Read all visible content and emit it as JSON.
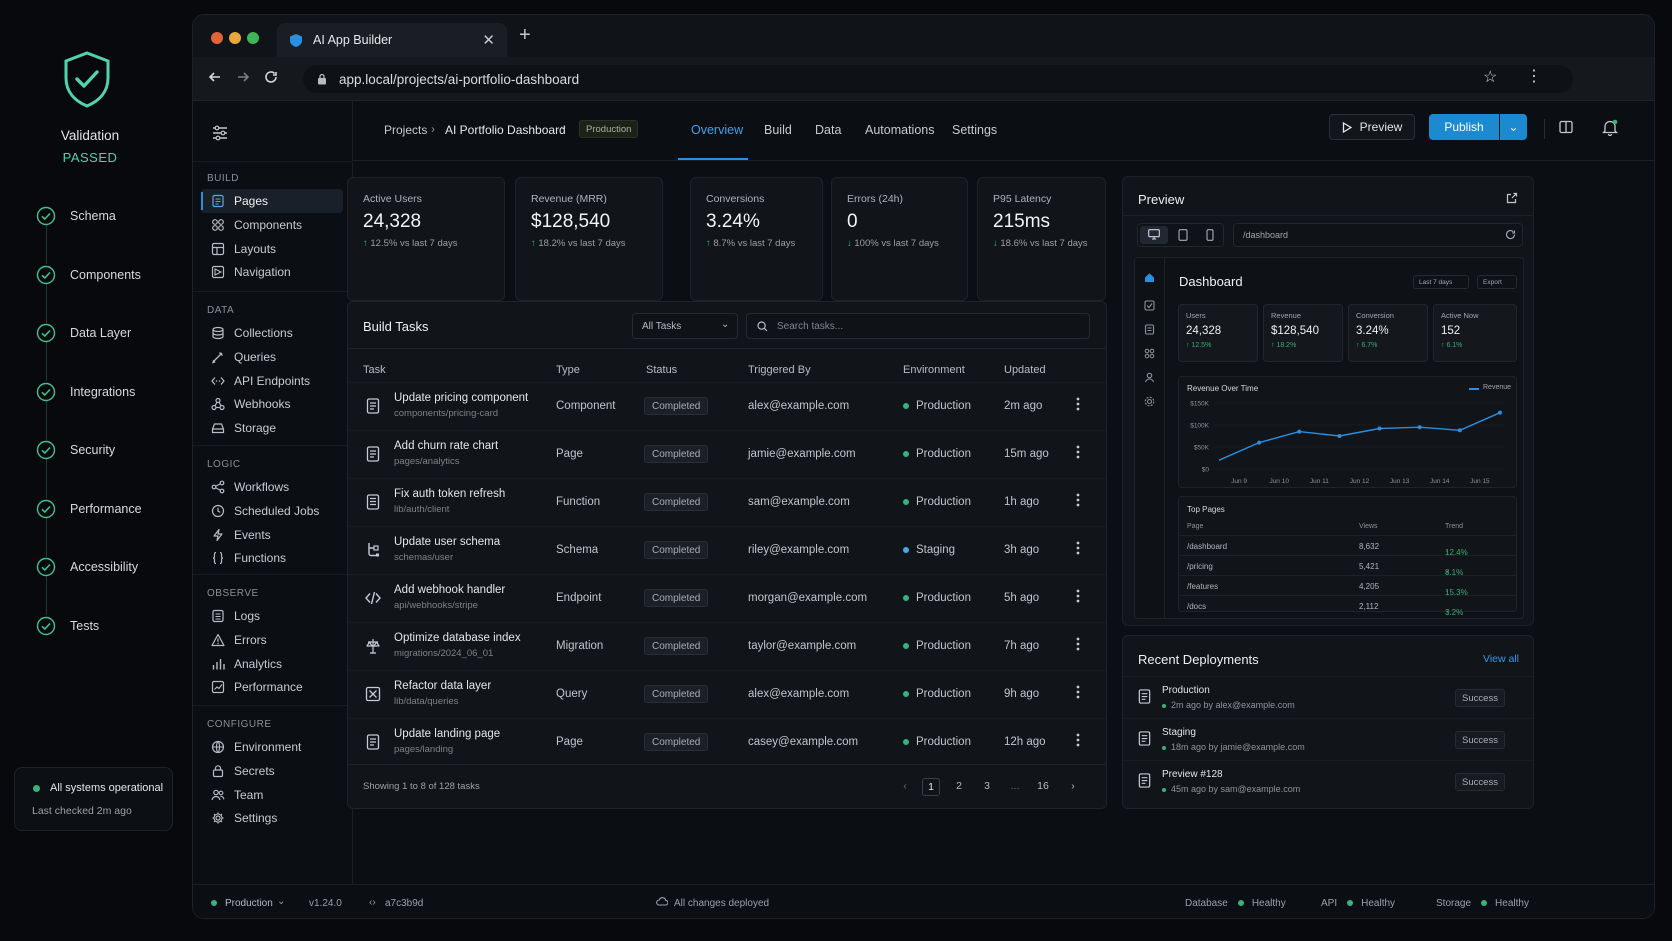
{
  "validation": {
    "title": "Validation",
    "status": "PASSED",
    "steps": [
      "Schema",
      "Components",
      "Data Layer",
      "Integrations",
      "Security",
      "Performance",
      "Accessibility",
      "Tests"
    ],
    "system": {
      "status": "All systems operational",
      "checked": "Last checked 2m ago"
    }
  },
  "browser": {
    "tab_title": "AI App Builder",
    "url": "app.local/projects/ai-portfolio-dashboard"
  },
  "sidebar": {
    "sections": [
      {
        "title": "BUILD",
        "items": [
          {
            "label": "Pages",
            "icon": "pages-icon"
          },
          {
            "label": "Components",
            "icon": "components-icon"
          },
          {
            "label": "Layouts",
            "icon": "layouts-icon"
          },
          {
            "label": "Navigation",
            "icon": "navigation-icon"
          }
        ]
      },
      {
        "title": "DATA",
        "items": [
          {
            "label": "Collections",
            "icon": "database-icon"
          },
          {
            "label": "Queries",
            "icon": "query-icon"
          },
          {
            "label": "API Endpoints",
            "icon": "api-icon"
          },
          {
            "label": "Webhooks",
            "icon": "webhook-icon"
          },
          {
            "label": "Storage",
            "icon": "storage-icon"
          }
        ]
      },
      {
        "title": "LOGIC",
        "items": [
          {
            "label": "Workflows",
            "icon": "workflow-icon"
          },
          {
            "label": "Scheduled Jobs",
            "icon": "clock-icon"
          },
          {
            "label": "Events",
            "icon": "bolt-icon"
          },
          {
            "label": "Functions",
            "icon": "braces-icon"
          }
        ]
      },
      {
        "title": "OBSERVE",
        "items": [
          {
            "label": "Logs",
            "icon": "logs-icon"
          },
          {
            "label": "Errors",
            "icon": "warning-icon"
          },
          {
            "label": "Analytics",
            "icon": "bar-chart-icon"
          },
          {
            "label": "Performance",
            "icon": "performance-icon"
          }
        ]
      },
      {
        "title": "CONFIGURE",
        "items": [
          {
            "label": "Environment",
            "icon": "globe-icon"
          },
          {
            "label": "Secrets",
            "icon": "lock-icon"
          },
          {
            "label": "Team",
            "icon": "team-icon"
          },
          {
            "label": "Settings",
            "icon": "gear-icon"
          }
        ]
      }
    ]
  },
  "header": {
    "breadcrumb_root": "Projects",
    "project": "AI Portfolio Dashboard",
    "env_badge": "Production",
    "tabs": [
      "Overview",
      "Build",
      "Data",
      "Automations",
      "Settings"
    ],
    "active_tab": "Overview",
    "preview_label": "Preview",
    "publish_label": "Publish"
  },
  "metrics": [
    {
      "label": "Active Users",
      "value": "24,328",
      "change": "12.5%",
      "dir": "up",
      "suffix": "vs last 7 days"
    },
    {
      "label": "Revenue (MRR)",
      "value": "$128,540",
      "change": "18.2%",
      "dir": "up",
      "suffix": "vs last 7 days"
    },
    {
      "label": "Conversions",
      "value": "3.24%",
      "change": "8.7%",
      "dir": "up",
      "suffix": "vs last 7 days"
    },
    {
      "label": "Errors (24h)",
      "value": "0",
      "change": "100%",
      "dir": "down",
      "suffix": "vs last 7 days"
    },
    {
      "label": "P95 Latency",
      "value": "215ms",
      "change": "18.6%",
      "dir": "down",
      "suffix": "vs last 7 days"
    }
  ],
  "build_tasks": {
    "title": "Build Tasks",
    "filter": "All Tasks",
    "search_placeholder": "Search tasks...",
    "columns": [
      "Task",
      "Type",
      "Status",
      "Triggered By",
      "Environment",
      "Updated"
    ],
    "rows": [
      {
        "name": "Update pricing component",
        "path": "components/pricing-card",
        "type": "Component",
        "status": "Completed",
        "by": "alex@example.com",
        "env": "Production",
        "updated": "2m ago",
        "icon": "file-icon"
      },
      {
        "name": "Add churn rate chart",
        "path": "pages/analytics",
        "type": "Page",
        "status": "Completed",
        "by": "jamie@example.com",
        "env": "Production",
        "updated": "15m ago",
        "icon": "file-icon"
      },
      {
        "name": "Fix auth token refresh",
        "path": "lib/auth/client",
        "type": "Function",
        "status": "Completed",
        "by": "sam@example.com",
        "env": "Production",
        "updated": "1h ago",
        "icon": "function-icon"
      },
      {
        "name": "Update user schema",
        "path": "schemas/user",
        "type": "Schema",
        "status": "Completed",
        "by": "riley@example.com",
        "env": "Staging",
        "updated": "3h ago",
        "icon": "schema-icon"
      },
      {
        "name": "Add webhook handler",
        "path": "api/webhooks/stripe",
        "type": "Endpoint",
        "status": "Completed",
        "by": "morgan@example.com",
        "env": "Production",
        "updated": "5h ago",
        "icon": "code-icon"
      },
      {
        "name": "Optimize database index",
        "path": "migrations/2024_06_01",
        "type": "Migration",
        "status": "Completed",
        "by": "taylor@example.com",
        "env": "Production",
        "updated": "7h ago",
        "icon": "migration-icon"
      },
      {
        "name": "Refactor data layer",
        "path": "lib/data/queries",
        "type": "Query",
        "status": "Completed",
        "by": "alex@example.com",
        "env": "Production",
        "updated": "9h ago",
        "icon": "query-box-icon"
      },
      {
        "name": "Update landing page",
        "path": "pages/landing",
        "type": "Page",
        "status": "Completed",
        "by": "casey@example.com",
        "env": "Production",
        "updated": "12h ago",
        "icon": "file-icon"
      }
    ],
    "footer": "Showing 1 to 8 of 128 tasks",
    "pages": [
      "1",
      "2",
      "3",
      "...",
      "16"
    ]
  },
  "preview": {
    "title": "Preview",
    "path": "/dashboard",
    "dashboard_title": "Dashboard",
    "range": "Last 7 days",
    "export": "Export",
    "kpis": [
      {
        "label": "Users",
        "value": "24,328",
        "change": "12.5%"
      },
      {
        "label": "Revenue",
        "value": "$128,540",
        "change": "18.2%"
      },
      {
        "label": "Conversion",
        "value": "3.24%",
        "change": "6.7%"
      },
      {
        "label": "Active Now",
        "value": "152",
        "change": "6.1%"
      }
    ],
    "chart_data": {
      "type": "line",
      "title": "Revenue Over Time",
      "x": [
        "Jun 9",
        "Jun 10",
        "Jun 11",
        "Jun 12",
        "Jun 13",
        "Jun 14",
        "Jun 15"
      ],
      "y_ticks": [
        "$150K",
        "$100K",
        "$50K",
        "$0"
      ],
      "ylim": [
        0,
        150
      ],
      "series": [
        {
          "name": "Revenue",
          "values": [
            20,
            60,
            85,
            75,
            92,
            95,
            88,
            128
          ]
        }
      ],
      "x_points": [
        8.5,
        10,
        11,
        12,
        13,
        14,
        15
      ]
    },
    "top_pages": {
      "title": "Top Pages",
      "columns": [
        "Page",
        "Views",
        "Trend"
      ],
      "rows": [
        {
          "page": "/dashboard",
          "views": "8,632",
          "trend": "12.4%"
        },
        {
          "page": "/pricing",
          "views": "5,421",
          "trend": "8.1%"
        },
        {
          "page": "/features",
          "views": "4,205",
          "trend": "15.3%"
        },
        {
          "page": "/docs",
          "views": "2,112",
          "trend": "3.2%"
        }
      ]
    }
  },
  "deployments": {
    "title": "Recent Deployments",
    "view_all": "View all",
    "items": [
      {
        "name": "Production",
        "meta": "2m ago by alex@example.com",
        "status": "Success"
      },
      {
        "name": "Staging",
        "meta": "18m ago by jamie@example.com",
        "status": "Success"
      },
      {
        "name": "Preview #128",
        "meta": "45m ago by sam@example.com",
        "status": "Success"
      }
    ]
  },
  "statusbar": {
    "env": "Production",
    "version": "v1.24.0",
    "commit": "a7c3b9d",
    "deploy_state": "All changes deployed",
    "services": [
      {
        "name": "Database",
        "state": "Healthy"
      },
      {
        "name": "API",
        "state": "Healthy"
      },
      {
        "name": "Storage",
        "state": "Healthy"
      }
    ]
  },
  "colors": {
    "accent": "#1b8ad1",
    "success": "#3ab27a",
    "staging": "#4aa8e8",
    "bg": "#0b0e12"
  }
}
